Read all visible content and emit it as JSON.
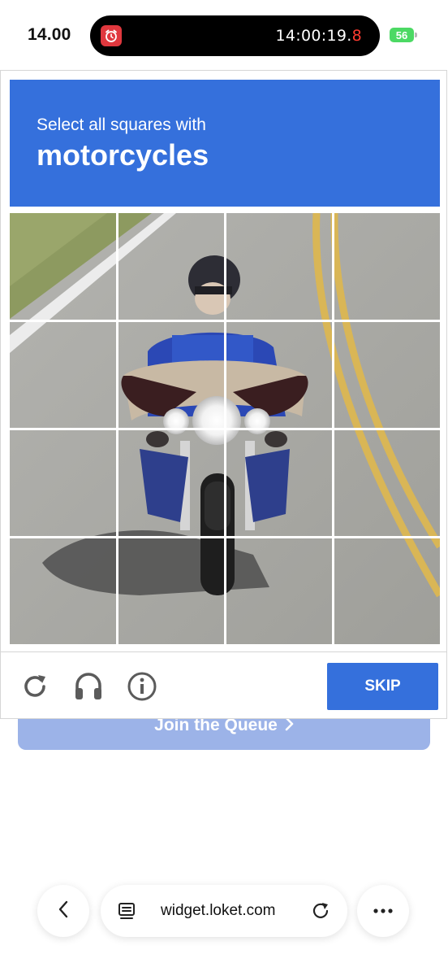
{
  "status_bar": {
    "time": "14.00",
    "timer_main": "14:00:19.",
    "timer_red": "8",
    "battery": "56"
  },
  "page": {
    "join_button": "Join the Queue"
  },
  "captcha": {
    "prompt": "Select all squares with",
    "target": "motorcycles",
    "skip_label": "SKIP",
    "icons": [
      "reload-icon",
      "audio-icon",
      "info-icon"
    ]
  },
  "browser": {
    "url": "widget.loket.com"
  },
  "colors": {
    "accent": "#3570dc",
    "join_button": "#9cb3e8",
    "battery": "#4cd964",
    "alarm": "#e0383e"
  }
}
